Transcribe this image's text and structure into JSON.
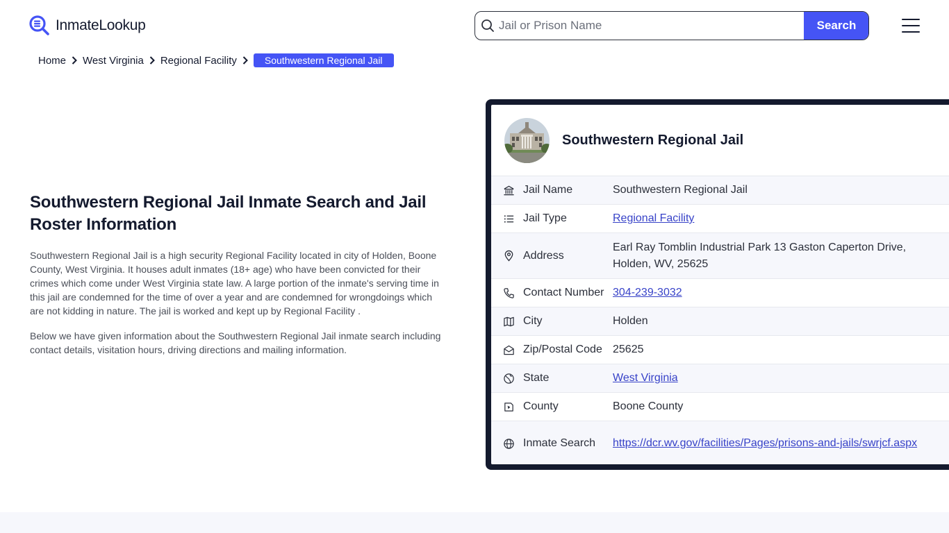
{
  "header": {
    "logo_text": "InmateLookup",
    "search_placeholder": "Jail or Prison Name",
    "search_button": "Search"
  },
  "breadcrumb": {
    "items": [
      "Home",
      "West Virginia",
      "Regional Facility"
    ],
    "current": "Southwestern Regional Jail"
  },
  "main": {
    "title": "Southwestern Regional Jail Inmate Search and Jail Roster Information",
    "paragraphs": [
      "Southwestern Regional Jail is a high security Regional Facility located in city of Holden, Boone County, West Virginia. It houses adult inmates (18+ age) who have been convicted for their crimes which come under West Virginia state law. A large portion of the inmate's serving time in this jail are condemned for the time of over a year and are condemned for wrongdoings which are not kidding in nature. The jail is worked and kept up by Regional Facility .",
      "Below we have given information about the Southwestern Regional Jail inmate search including contact details, visitation hours, driving directions and mailing information."
    ]
  },
  "card": {
    "title": "Southwestern Regional Jail",
    "rows": [
      {
        "icon": "bank-icon",
        "label": "Jail Name",
        "value": "Southwestern Regional Jail"
      },
      {
        "icon": "list-icon",
        "label": "Jail Type",
        "value": "Regional Facility"
      },
      {
        "icon": "map-pin-icon",
        "label": "Address",
        "value": "Earl Ray Tomblin Industrial Park 13 Gaston Caperton Drive, Holden, WV, 25625"
      },
      {
        "icon": "phone-icon",
        "label": "Contact Number",
        "value": "304-239-3032"
      },
      {
        "icon": "map-icon",
        "label": "City",
        "value": "Holden"
      },
      {
        "icon": "mail-icon",
        "label": "Zip/Postal Code",
        "value": "25625"
      },
      {
        "icon": "globe-icon",
        "label": "State",
        "value": "West Virginia"
      },
      {
        "icon": "county-icon",
        "label": "County",
        "value": "Boone County"
      },
      {
        "icon": "web-icon",
        "label": "Inmate Search",
        "value": "https://dcr.wv.gov/facilities/Pages/prisons-and-jails/swrjcf.aspx"
      }
    ]
  },
  "colors": {
    "accent": "#4554f5",
    "dark": "#141a2e",
    "link": "#3742c8"
  }
}
